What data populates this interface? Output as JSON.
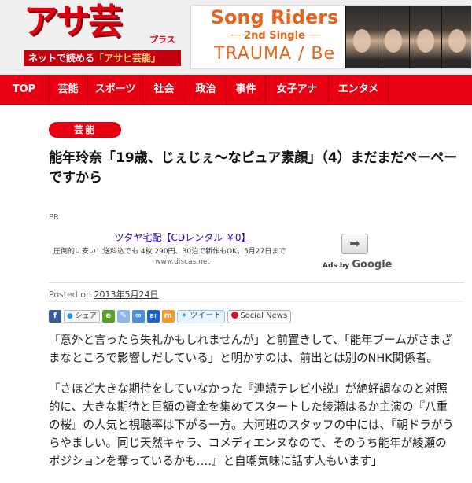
{
  "header": {
    "logo_main": "アサ芸",
    "logo_plus": "プラス",
    "logo_tagline_prefix": "ネットで読める",
    "logo_tagline_em": "「アサヒ芸能」"
  },
  "banner": {
    "title": "Song Riders",
    "subtitle": "── 2nd Single ──",
    "release": "TRAUMA / Be"
  },
  "nav": {
    "items": [
      "TOP",
      "芸能",
      "スポーツ",
      "社会",
      "政治",
      "事件",
      "女子アナ",
      "エンタメ"
    ]
  },
  "article": {
    "category": "芸能",
    "title": "能年玲奈「19歳、じぇじぇ〜なピュア素顔」（4）まだまだペーペーですから",
    "posted_label": "Posted on",
    "posted_date": "2013年5月24日",
    "paragraphs": [
      "「意外と言ったら失礼かもしれませんが」と前置きして、「能年ブームがさまざまなところで影響しだしている」と明かすのは、前出とは別のNHK関係者。",
      "「さほど大きな期待をしていなかった『連続テレビ小説』が絶好調なのと対照的に、大きな期待と巨額の資金を集めてスタートした綾瀬はるか主演の『八重の桜』の人気と視聴率は下がる一方。大河班のスタッフの中には、『朝ドラがうらやましい。同じ天然キャラ、コメディエンヌなので、そのうち能年が綾瀬のポジションを奪っているかも‥‥』と自嘲気味に話す人もいます」"
    ]
  },
  "ad": {
    "pr_label": "PR",
    "title": "ツタヤ宅配【CDレンタル ￥0】",
    "description": "圧倒的に安い！送料込でも 4枚 290円、30泊で新作もOK。5月27日まで",
    "url": "www.discas.net",
    "ads_by": "Ads by",
    "google": "Google"
  },
  "share": {
    "share_label": "シェア",
    "tweet_label": "ツイート",
    "social_news_label": "Social News"
  }
}
